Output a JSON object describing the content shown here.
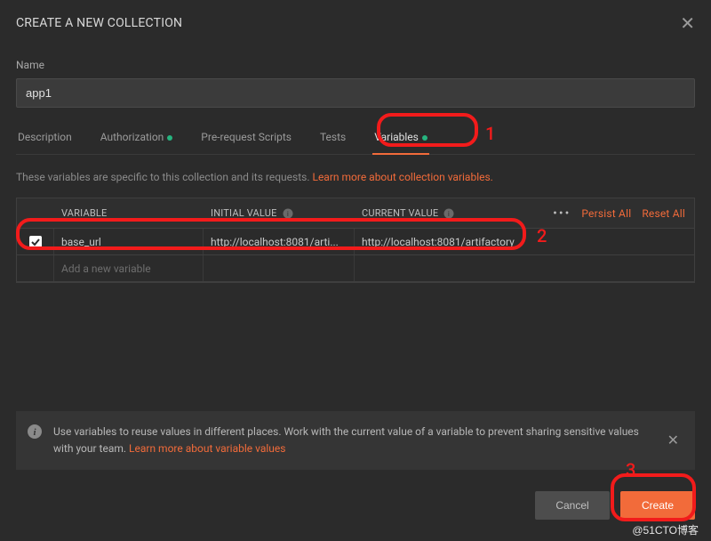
{
  "modal": {
    "title": "CREATE A NEW COLLECTION"
  },
  "name": {
    "label": "Name",
    "value": "app1"
  },
  "tabs": [
    {
      "label": "Description",
      "dot": false,
      "active": false
    },
    {
      "label": "Authorization",
      "dot": true,
      "active": false
    },
    {
      "label": "Pre-request Scripts",
      "dot": false,
      "active": false
    },
    {
      "label": "Tests",
      "dot": false,
      "active": false
    },
    {
      "label": "Variables",
      "dot": true,
      "active": true
    }
  ],
  "help": {
    "text": "These variables are specific to this collection and its requests.",
    "link": "Learn more about collection variables."
  },
  "table": {
    "headers": {
      "variable": "VARIABLE",
      "initial": "INITIAL VALUE",
      "current": "CURRENT VALUE"
    },
    "actions": {
      "persist": "Persist All",
      "reset": "Reset All"
    },
    "rows": [
      {
        "checked": true,
        "variable": "base_url",
        "initial": "http://localhost:8081/arti...",
        "current": "http://localhost:8081/artifactory"
      }
    ],
    "add_placeholder": "Add a new variable"
  },
  "banner": {
    "text": "Use variables to reuse values in different places. Work with the current value of a variable to prevent sharing sensitive values with your team.",
    "link": "Learn more about variable values"
  },
  "footer": {
    "cancel": "Cancel",
    "create": "Create"
  },
  "annotations": {
    "a1": "1",
    "a2": "2",
    "a3": "3"
  },
  "watermark": "@51CTO博客"
}
